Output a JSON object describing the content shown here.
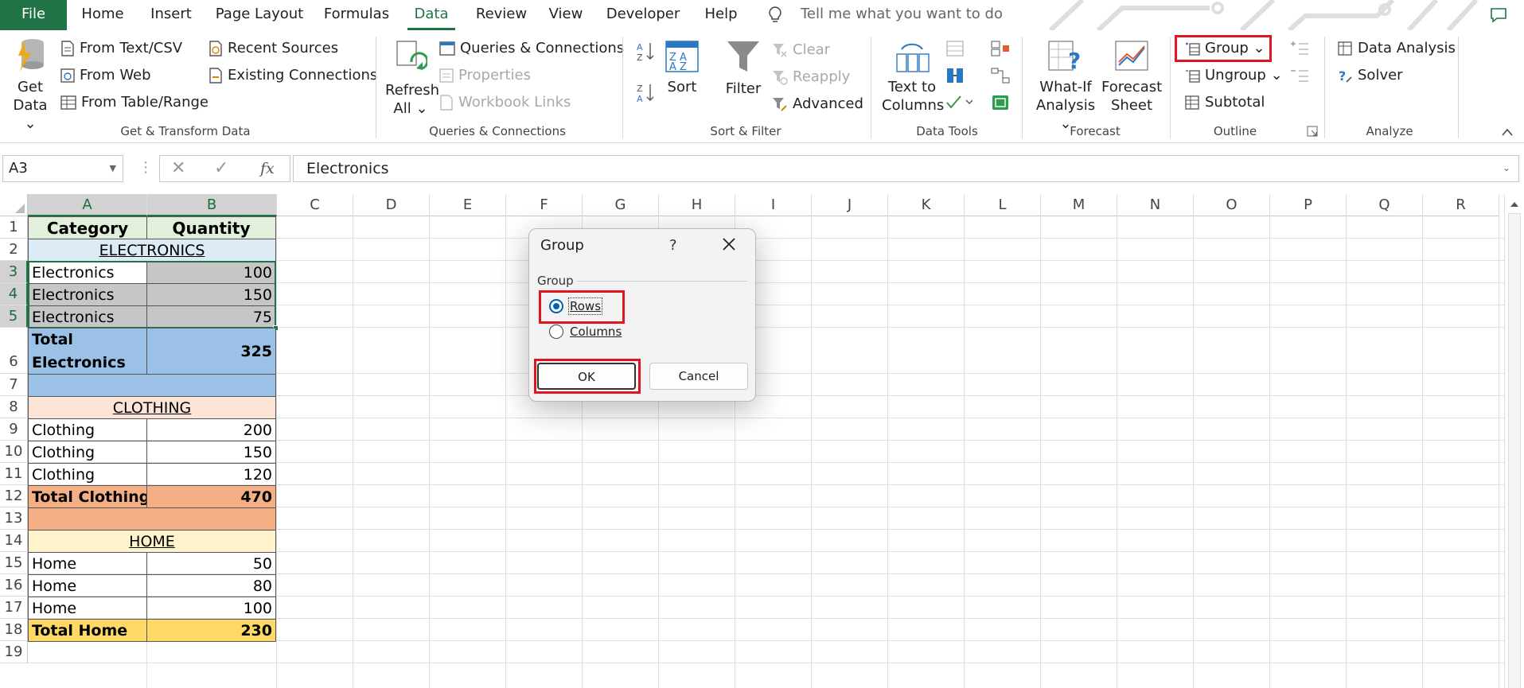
{
  "tabs": [
    "File",
    "Home",
    "Insert",
    "Page Layout",
    "Formulas",
    "Data",
    "Review",
    "View",
    "Developer",
    "Help"
  ],
  "tell_me": "Tell me what you want to do",
  "ribbon": {
    "get_data": [
      "Get",
      "Data"
    ],
    "from_text_csv": "From Text/CSV",
    "from_web": "From Web",
    "from_table_range": "From Table/Range",
    "recent_sources": "Recent Sources",
    "existing_connections": "Existing Connections",
    "group_get_transform": "Get & Transform Data",
    "refresh_all": [
      "Refresh",
      "All"
    ],
    "queries_connections": "Queries & Connections",
    "properties": "Properties",
    "workbook_links": "Workbook Links",
    "group_queries": "Queries & Connections",
    "sort": "Sort",
    "filter": "Filter",
    "clear": "Clear",
    "reapply": "Reapply",
    "advanced": "Advanced",
    "group_sort_filter": "Sort & Filter",
    "text_to_columns": [
      "Text to",
      "Columns"
    ],
    "group_data_tools": "Data Tools",
    "what_if": [
      "What-If",
      "Analysis"
    ],
    "forecast_sheet": [
      "Forecast",
      "Sheet"
    ],
    "group_forecast": "Forecast",
    "group_btn": "Group",
    "ungroup": "Ungroup",
    "subtotal": "Subtotal",
    "group_outline": "Outline",
    "data_analysis": "Data Analysis",
    "solver": "Solver",
    "group_analyze": "Analyze"
  },
  "formula_bar": {
    "name_box": "A3",
    "fx": "fx",
    "value": "Electronics"
  },
  "columns": [
    "A",
    "B",
    "C",
    "D",
    "E",
    "F",
    "G",
    "H",
    "I",
    "J",
    "K",
    "L",
    "M",
    "N",
    "O",
    "P",
    "Q",
    "R"
  ],
  "rows": [
    "1",
    "2",
    "3",
    "4",
    "5",
    "6",
    "7",
    "8",
    "9",
    "10",
    "11",
    "12",
    "13",
    "14",
    "15",
    "16",
    "17",
    "18",
    "19"
  ],
  "cells": {
    "a1": "Category",
    "b1": "Quantity",
    "h2": "ELECTRONICS",
    "a3": "Electronics",
    "b3": "100",
    "a4": "Electronics",
    "b4": "150",
    "a5": "Electronics",
    "b5": "75",
    "a6_1": "Total",
    "a6_2": "Electronics",
    "b6": "325",
    "h8": "CLOTHING",
    "a9": "Clothing",
    "b9": "200",
    "a10": "Clothing",
    "b10": "150",
    "a11": "Clothing",
    "b11": "120",
    "a12": "Total Clothing",
    "b12": "470",
    "h14": "HOME",
    "a15": "Home",
    "b15": "50",
    "a16": "Home",
    "b16": "80",
    "a17": "Home",
    "b17": "100",
    "a18": "Total Home",
    "b18": "230"
  },
  "dialog": {
    "title": "Group",
    "help": "?",
    "group_label": "Group",
    "rows": "Rows",
    "columns": "Columns",
    "selected": "Rows",
    "ok": "OK",
    "cancel": "Cancel"
  },
  "colors": {
    "excel_green": "#217346",
    "highlight_red": "#e0151f",
    "header_green": "#e2efda",
    "electronics_light": "#ddebf7",
    "electronics_total": "#9bc2e6",
    "clothing_light": "#fce4d6",
    "clothing_total": "#f4b084",
    "home_light": "#fff2cc",
    "home_total": "#ffd966",
    "selection_gray": "#c6c6c6"
  }
}
